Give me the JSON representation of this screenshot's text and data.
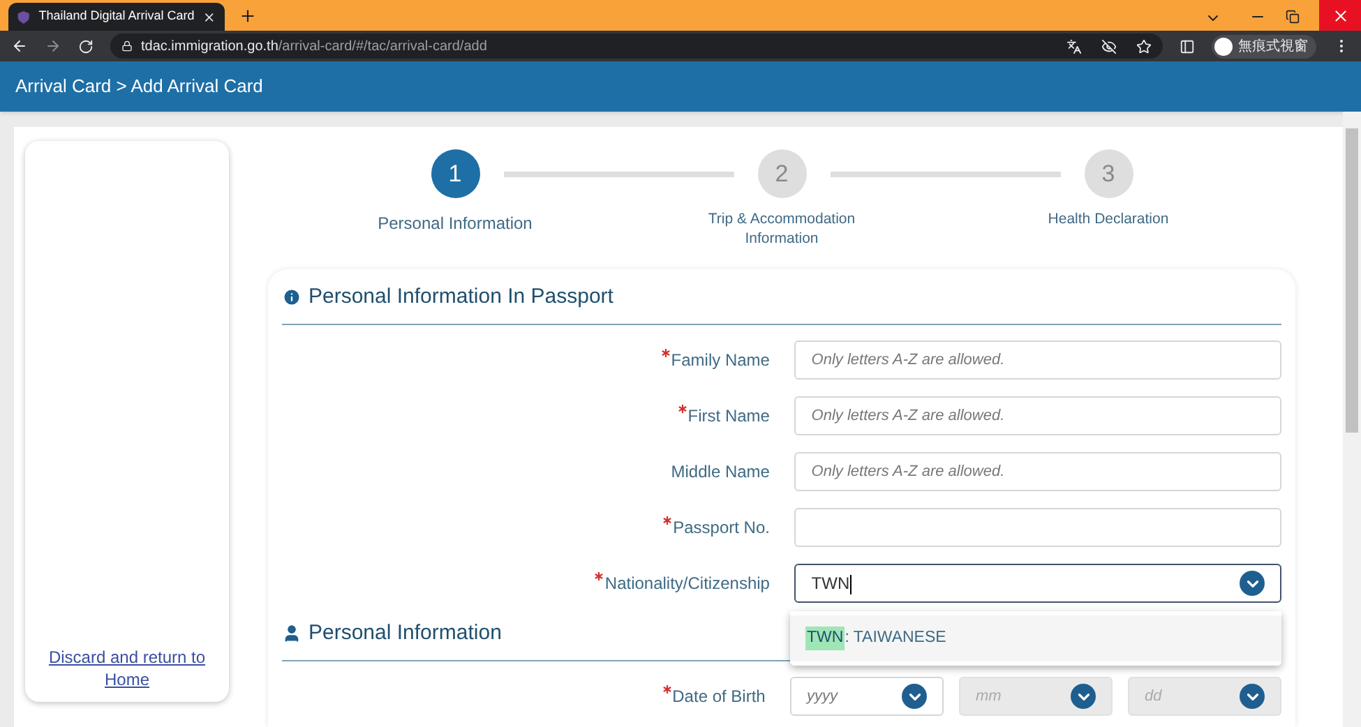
{
  "browser": {
    "tab_title": "Thailand Digital Arrival Card",
    "url_host": "tdac.immigration.go.th",
    "url_path": "/arrival-card/#/tac/arrival-card/add",
    "profile_label": "無痕式視窗"
  },
  "header": {
    "breadcrumb": "Arrival Card > Add Arrival Card"
  },
  "sidebar": {
    "link": "Discard and return to Home"
  },
  "steps": [
    {
      "number": "1",
      "label": "Personal Information",
      "selected": true
    },
    {
      "number": "2",
      "label": "Trip & Accommodation Information",
      "selected": false
    },
    {
      "number": "3",
      "label": "Health Declaration",
      "selected": false
    }
  ],
  "passport_section": {
    "title": "Personal Information In Passport",
    "fields": [
      {
        "label": "Family Name",
        "required": true,
        "kind": "text",
        "placeholder": "Only letters A-Z are allowed."
      },
      {
        "label": "First Name",
        "required": true,
        "kind": "text",
        "placeholder": "Only letters A-Z are allowed."
      },
      {
        "label": "Middle Name",
        "required": false,
        "kind": "text",
        "placeholder": "Only letters A-Z are allowed."
      },
      {
        "label": "Passport No.",
        "required": true,
        "kind": "text"
      },
      {
        "label": "Nationality/Citizenship",
        "required": true,
        "kind": "combo",
        "value": "TWN"
      }
    ],
    "suggestions": [
      {
        "match": "TWN",
        "rest": " : TAIWANESE"
      }
    ]
  },
  "personal_section": {
    "title": "Personal Information",
    "date_of_birth": {
      "label": "Date of Birth",
      "required": true,
      "parts": [
        {
          "placeholder": "yyyy",
          "disabled": false
        },
        {
          "placeholder": "mm",
          "disabled": true
        },
        {
          "placeholder": "dd",
          "disabled": true
        }
      ]
    }
  }
}
